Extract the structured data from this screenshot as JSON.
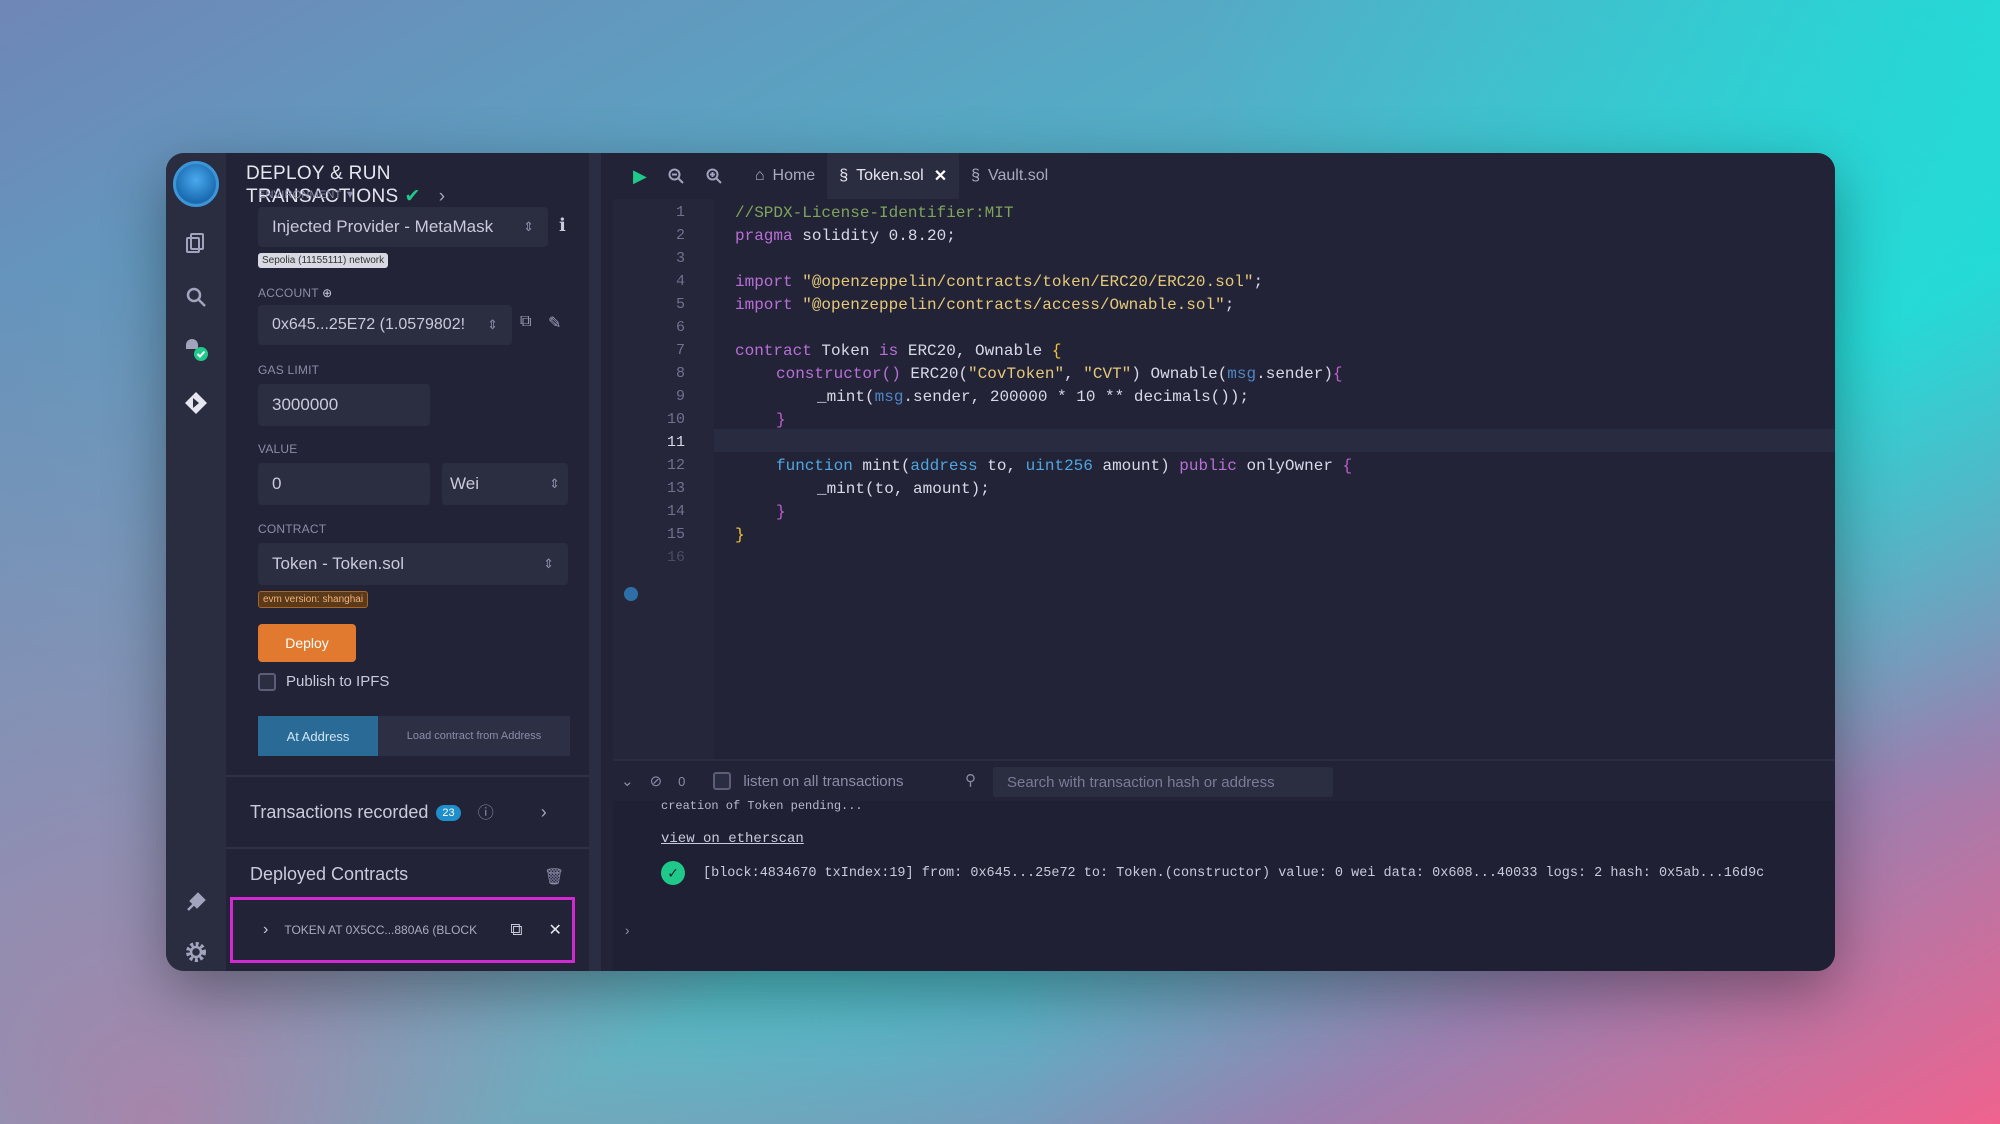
{
  "panel": {
    "title": "DEPLOY & RUN TRANSACTIONS",
    "environment_label": "ENVIRONMENT",
    "environment_value": "Injected Provider - MetaMask",
    "network_badge": "Sepolia (11155111) network",
    "account_label": "ACCOUNT",
    "account_value": "0x645...25E72 (1.0579802!",
    "gas_limit_label": "GAS LIMIT",
    "gas_limit_value": "3000000",
    "value_label": "VALUE",
    "value_amount": "0",
    "value_unit": "Wei",
    "contract_label": "CONTRACT",
    "contract_value": "Token - Token.sol",
    "evm_badge": "evm version: shanghai",
    "deploy_label": "Deploy",
    "publish_label": "Publish to IPFS",
    "at_address_label": "At Address",
    "load_contract_label": "Load contract from Address",
    "transactions_recorded_label": "Transactions recorded",
    "transactions_count": "23",
    "deployed_contracts_label": "Deployed Contracts",
    "deployed_item": "TOKEN AT 0X5CC...880A6 (BLOCK"
  },
  "tabs": {
    "home": "Home",
    "token": "Token.sol",
    "vault": "Vault.sol"
  },
  "editor": {
    "line_numbers": [
      "1",
      "2",
      "3",
      "4",
      "5",
      "6",
      "7",
      "8",
      "9",
      "10",
      "11",
      "12",
      "13",
      "14",
      "15",
      "16"
    ],
    "code": {
      "l1": "//SPDX-License-Identifier:MIT",
      "l2_kw": "pragma",
      "l2_rest": " solidity 0.8.20;",
      "l4_kw": "import",
      "l4_str": "\"@openzeppelin/contracts/token/ERC20/ERC20.sol\"",
      "l5_kw": "import",
      "l5_str": "\"@openzeppelin/contracts/access/Ownable.sol\"",
      "l7_kw": "contract",
      "l7_name": " Token ",
      "l7_is": "is",
      "l7_rest": " ERC20, Ownable ",
      "l8_fn": "constructor",
      "l8_a": " ERC20(",
      "l8_s1": "\"CovToken\"",
      "l8_c": ", ",
      "l8_s2": "\"CVT\"",
      "l8_b": ") Ownable(",
      "l8_msg": "msg",
      "l8_end": ".sender)",
      "l9_a": "_mint(",
      "l9_msg": "msg",
      "l9_rest": ".sender, 200000 * 10 ** decimals());",
      "l12_kw": "function",
      "l12_a": " mint(",
      "l12_t1": "address",
      "l12_b": " to, ",
      "l12_t2": "uint256",
      "l12_c": " amount) ",
      "l12_pub": "public",
      "l12_d": " onlyOwner ",
      "l13": "_mint(to, amount);",
      "semi": ";"
    }
  },
  "terminal": {
    "count": "0",
    "listen_label": "listen on all transactions",
    "search_placeholder": "Search with transaction hash or address",
    "pending_text": "creation of Token pending...",
    "etherscan_link": "view on etherscan",
    "tx_line": "[block:4834670 txIndex:19] from: 0x645...25e72 to: Token.(constructor) value: 0 wei data: 0x608...40033 logs: 2 hash: 0x5ab...16d9c"
  },
  "colors": {
    "accent_deploy": "#e1792f",
    "accent_at_address": "#2a6a96",
    "success": "#1ec98a",
    "highlight_border": "#d12ad3"
  }
}
